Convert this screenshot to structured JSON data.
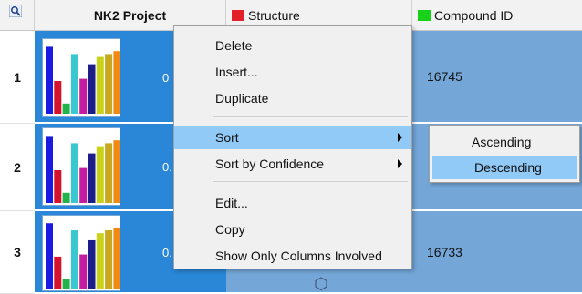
{
  "header": {
    "project_label": "NK2 Project",
    "structure_label": "Structure",
    "compound_id_label": "Compound ID",
    "structure_color": "#e2202a",
    "compound_id_color": "#18d21a"
  },
  "rows": [
    {
      "num": "1",
      "score": "0",
      "compound_id": "16745",
      "row_state": "selected"
    },
    {
      "num": "2",
      "score": "0.",
      "compound_id": "",
      "row_state": "selected"
    },
    {
      "num": "3",
      "score": "0.",
      "compound_id": "16733",
      "row_state": "selected"
    }
  ],
  "thumbnail_bars": {
    "colors": [
      "#1a1ae0",
      "#d4122e",
      "#22b34a",
      "#39c8d0",
      "#c21ca0",
      "#1d1d8a",
      "#c8d21a",
      "#c8a81e",
      "#f08a12"
    ],
    "levels": [
      0.92,
      0.45,
      0.14,
      0.82,
      0.48,
      0.68,
      0.78,
      0.82,
      0.86
    ]
  },
  "context_menu": {
    "items": {
      "delete": "Delete",
      "insert": "Insert...",
      "duplicate": "Duplicate",
      "sort": "Sort",
      "sort_confidence": "Sort by Confidence",
      "edit": "Edit...",
      "copy": "Copy",
      "show_only": "Show Only Columns Involved"
    },
    "highlighted": "Sort"
  },
  "sort_submenu": {
    "ascending": "Ascending",
    "descending": "Descending",
    "highlighted": "Descending"
  },
  "colors": {
    "selected_cell": "#2a86d6",
    "row_cell": "#74a7d8",
    "menu_highlight": "#91c9f7"
  }
}
